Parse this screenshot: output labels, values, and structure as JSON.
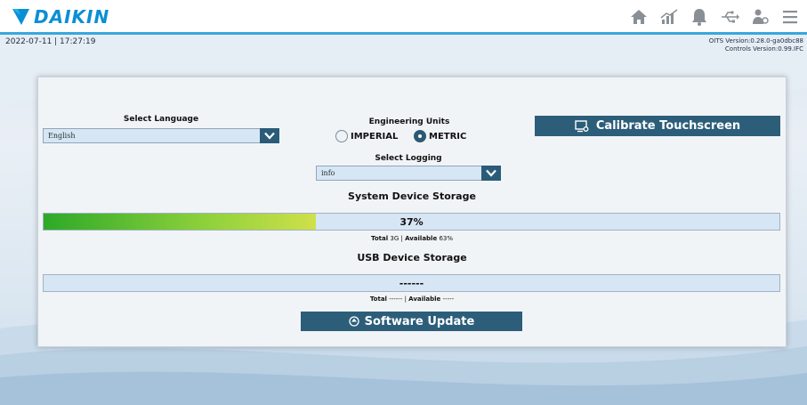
{
  "header": {
    "brand": "DAIKIN",
    "icons": [
      "home-icon",
      "trend-chart-icon",
      "alarm-bell-icon",
      "usb-icon",
      "service-person-icon",
      "menu-icon"
    ],
    "accent_color": "#0a8fd6",
    "line_color": "#3aa7dc"
  },
  "status": {
    "datetime": "2022-07-11 | 17:27:19",
    "oits_version": "OITS Version:0.28.0-ga0dbc88",
    "controls_version": "Controls Version:0.99.IFC"
  },
  "language": {
    "label": "Select Language",
    "value": "English"
  },
  "units": {
    "label": "Engineering Units",
    "options": [
      "IMPERIAL",
      "METRIC"
    ],
    "selected": "METRIC"
  },
  "logging": {
    "label": "Select Logging",
    "value": "info"
  },
  "calibrate": {
    "label": "Calibrate Touchscreen"
  },
  "system_storage": {
    "title": "System Device Storage",
    "percent_used": 37,
    "percent_text": "37%",
    "total_label": "Total",
    "total_value": "3G",
    "available_label": "Available",
    "available_value": "63%"
  },
  "usb_storage": {
    "title": "USB Device Storage",
    "value_text": "------",
    "total_label": "Total",
    "total_value": "------",
    "available_label": "Available",
    "available_value": "-----"
  },
  "software_update": {
    "label": "Software Update"
  }
}
